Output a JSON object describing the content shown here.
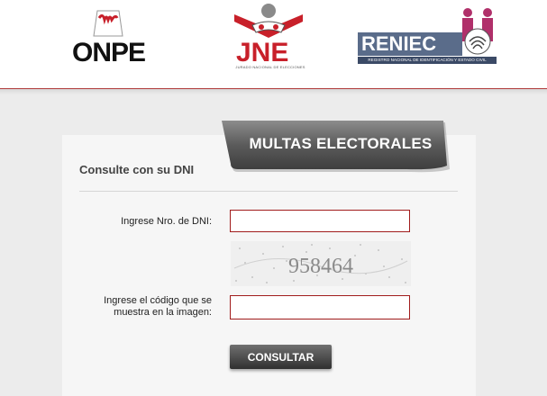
{
  "header": {
    "logos": {
      "onpe": {
        "name": "ONPE"
      },
      "jne": {
        "name": "JNE",
        "subtitle": "JURADO NACIONAL DE ELECCIONES"
      },
      "reniec": {
        "name": "RENIEC",
        "subtitle": "REGISTRO NACIONAL DE IDENTIFICACIÓN Y ESTADO CIVIL"
      }
    }
  },
  "form": {
    "tab_label": "MULTAS ELECTORALES",
    "title": "Consulte con su DNI",
    "dni_label": "Ingrese Nro. de DNI:",
    "dni_value": "",
    "captcha_text": "958464",
    "code_label_line1": "Ingrese el código que se",
    "code_label_line2": "muestra en la imagen:",
    "code_value": "",
    "submit_label": "CONSULTAR"
  },
  "colors": {
    "accent_red": "#a11c1c",
    "jne_red": "#c8202a",
    "reniec_blue": "#5a6c8a",
    "button_dark": "#303030"
  }
}
